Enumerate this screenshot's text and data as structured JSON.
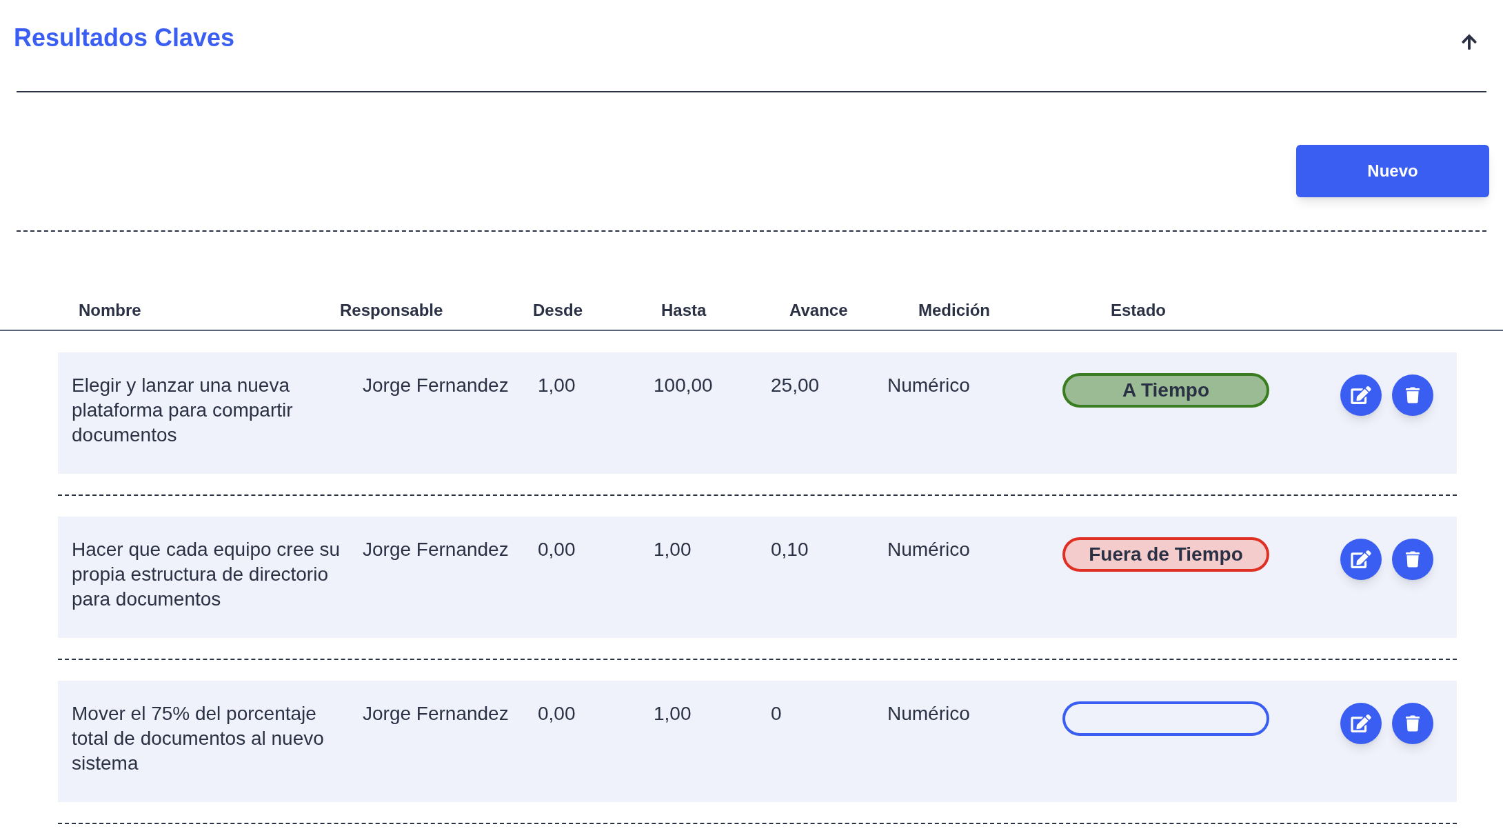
{
  "title": "Resultados Claves",
  "new_button": "Nuevo",
  "columns": [
    "Nombre",
    "Responsable",
    "Desde",
    "Hasta",
    "Avance",
    "Medición",
    "Estado"
  ],
  "rows": [
    {
      "name": "Elegir y lanzar una nueva plataforma para compartir documentos",
      "owner": "Jorge Fernandez",
      "from": "1,00",
      "to": "100,00",
      "progress": "25,00",
      "measure": "Numérico",
      "status": {
        "kind": "on_time",
        "label": "A Tiempo"
      }
    },
    {
      "name": "Hacer que cada equipo cree su propia estructura de directorio para documentos",
      "owner": "Jorge Fernandez",
      "from": "0,00",
      "to": "1,00",
      "progress": "0,10",
      "measure": "Numérico",
      "status": {
        "kind": "late",
        "label": "Fuera de Tiempo"
      }
    },
    {
      "name": "Mover el 75% del porcentaje total de documentos al nuevo sistema",
      "owner": "Jorge Fernandez",
      "from": "0,00",
      "to": "1,00",
      "progress": "0",
      "measure": "Numérico",
      "status": {
        "kind": "none"
      }
    }
  ]
}
